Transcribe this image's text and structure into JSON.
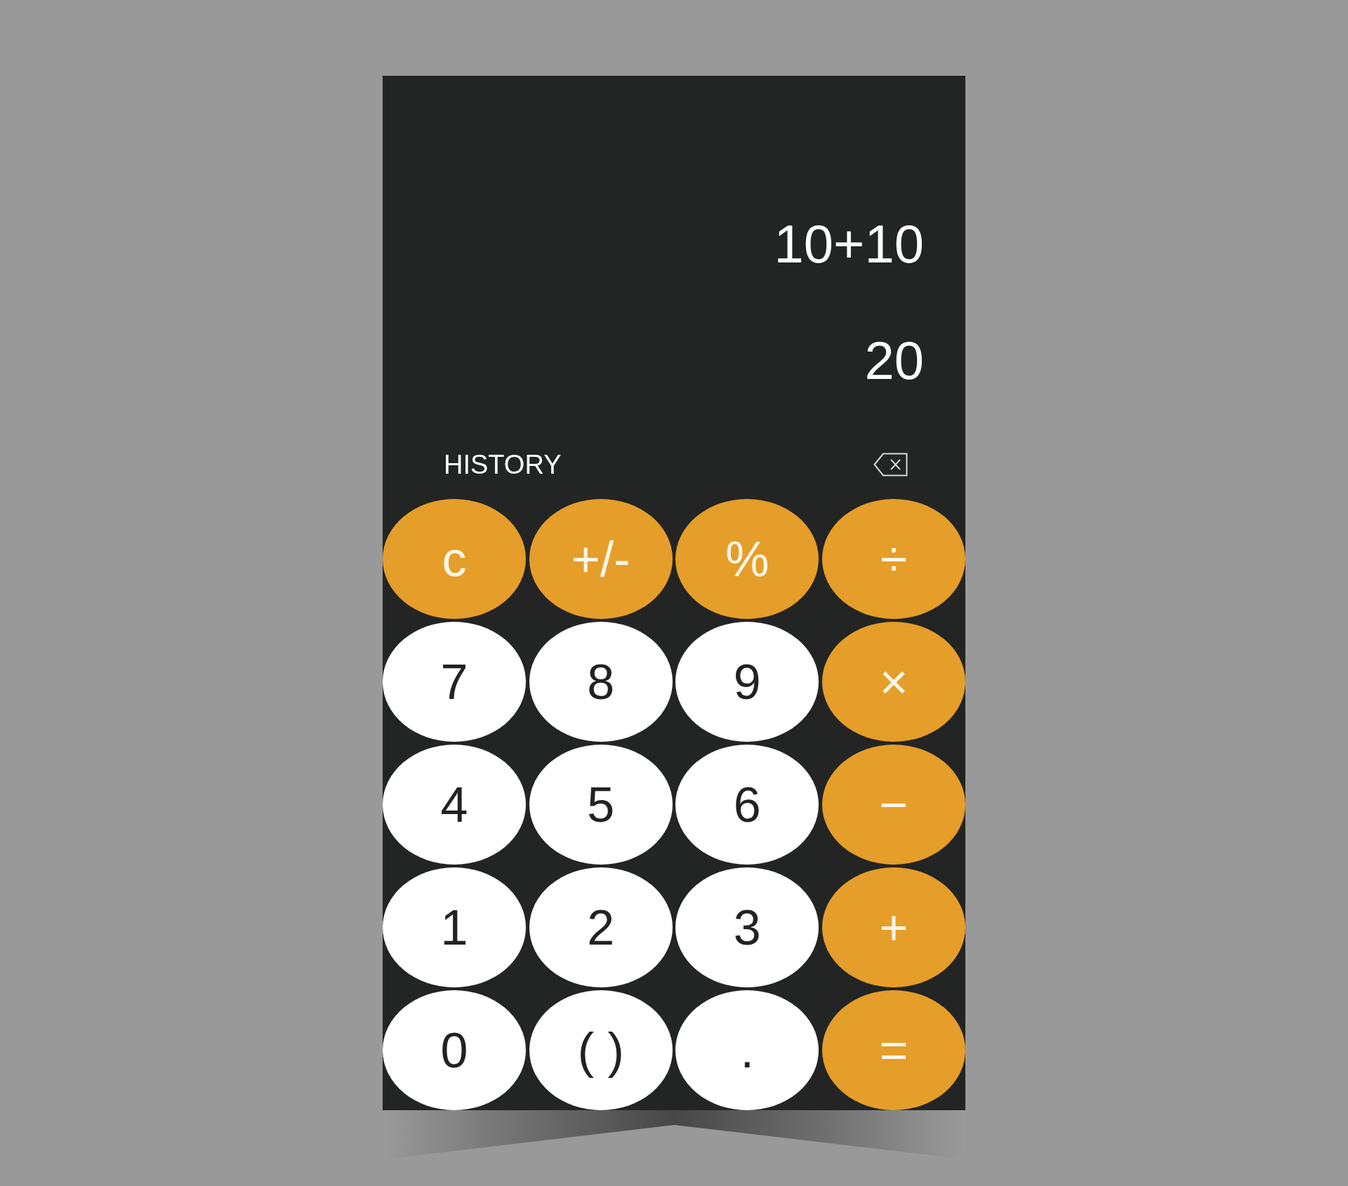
{
  "display": {
    "expression": "10+10",
    "result": "20"
  },
  "history_button": {
    "label": "HISTORY"
  },
  "keys": [
    {
      "label": "c",
      "kind": "operator"
    },
    {
      "label": "+/-",
      "kind": "operator"
    },
    {
      "label": "%",
      "kind": "operator"
    },
    {
      "label": "÷",
      "kind": "operator"
    },
    {
      "label": "7",
      "kind": "input"
    },
    {
      "label": "8",
      "kind": "input"
    },
    {
      "label": "9",
      "kind": "input"
    },
    {
      "label": "×",
      "kind": "operator"
    },
    {
      "label": "4",
      "kind": "input"
    },
    {
      "label": "5",
      "kind": "input"
    },
    {
      "label": "6",
      "kind": "input"
    },
    {
      "label": "−",
      "kind": "operator"
    },
    {
      "label": "1",
      "kind": "input"
    },
    {
      "label": "2",
      "kind": "input"
    },
    {
      "label": "3",
      "kind": "input"
    },
    {
      "label": "+",
      "kind": "operator"
    },
    {
      "label": "0",
      "kind": "input"
    },
    {
      "label": "( )",
      "kind": "input"
    },
    {
      "label": ".",
      "kind": "input"
    },
    {
      "label": "=",
      "kind": "operator"
    }
  ]
}
